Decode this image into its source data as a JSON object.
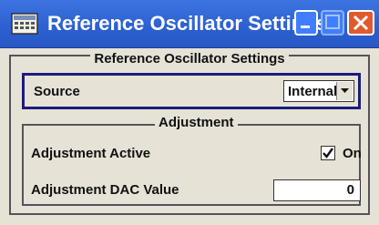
{
  "window": {
    "title": "Reference Oscillator Settings",
    "accent_color": "#2c5fcf",
    "buttons": {
      "minimize": "minimize-icon",
      "maximize": "maximize-icon",
      "close": "close-icon"
    }
  },
  "group": {
    "title": "Reference Oscillator Settings",
    "source": {
      "label": "Source",
      "value": "Internal"
    }
  },
  "adjustment": {
    "title": "Adjustment",
    "active": {
      "label": "Adjustment Active",
      "checked": true,
      "check_label": "On"
    },
    "dac": {
      "label": "Adjustment DAC Value",
      "value": "0"
    }
  }
}
